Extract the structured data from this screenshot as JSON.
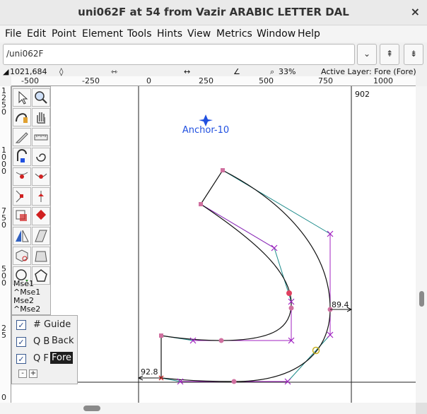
{
  "window": {
    "title": "uni062F at 54 from Vazir ARABIC LETTER DAL",
    "close": "×"
  },
  "menu": [
    "File",
    "Edit",
    "Point",
    "Element",
    "Tools",
    "Hints",
    "View",
    "Metrics",
    "Window",
    "Help"
  ],
  "toolbar": {
    "glyph_name": "/uni062F",
    "dropdown": "⌄",
    "prev": "⇞",
    "next": "⇟"
  },
  "status": {
    "coords": "1021,684",
    "zoom": "33%",
    "active_layer": "Active Layer: Fore (Fore)"
  },
  "ruler": {
    "h_ticks": [
      "-500",
      "-250",
      "0",
      "250",
      "500",
      "750",
      "1000"
    ],
    "v_labels": [
      "1",
      "2",
      "5",
      "0",
      "1",
      "0",
      "0",
      "0",
      "7",
      "5",
      "0",
      "5",
      "0",
      "0",
      "2",
      "5",
      "0"
    ]
  },
  "canvas": {
    "anchor_label": "Anchor-10",
    "advance_width": "902",
    "dim_right": "89.4",
    "dim_left": "92.8"
  },
  "tools": {
    "mse": [
      "Mse1",
      "^Mse1",
      "Mse2",
      "^Mse2"
    ]
  },
  "layers": [
    {
      "checked": true,
      "prefix": "",
      "name": "# Guide",
      "active": false
    },
    {
      "checked": true,
      "prefix": "Q B",
      "name": "Back",
      "active": false
    },
    {
      "checked": true,
      "prefix": "Q F",
      "name": "Fore",
      "active": true
    }
  ],
  "layer_buttons": {
    "minus": "-",
    "plus": "+"
  },
  "colors": {
    "outline": "#111111",
    "control": "#a020c0",
    "handle": "#1a8a8a",
    "point": "#d02060",
    "anchor": "#2050e0"
  }
}
